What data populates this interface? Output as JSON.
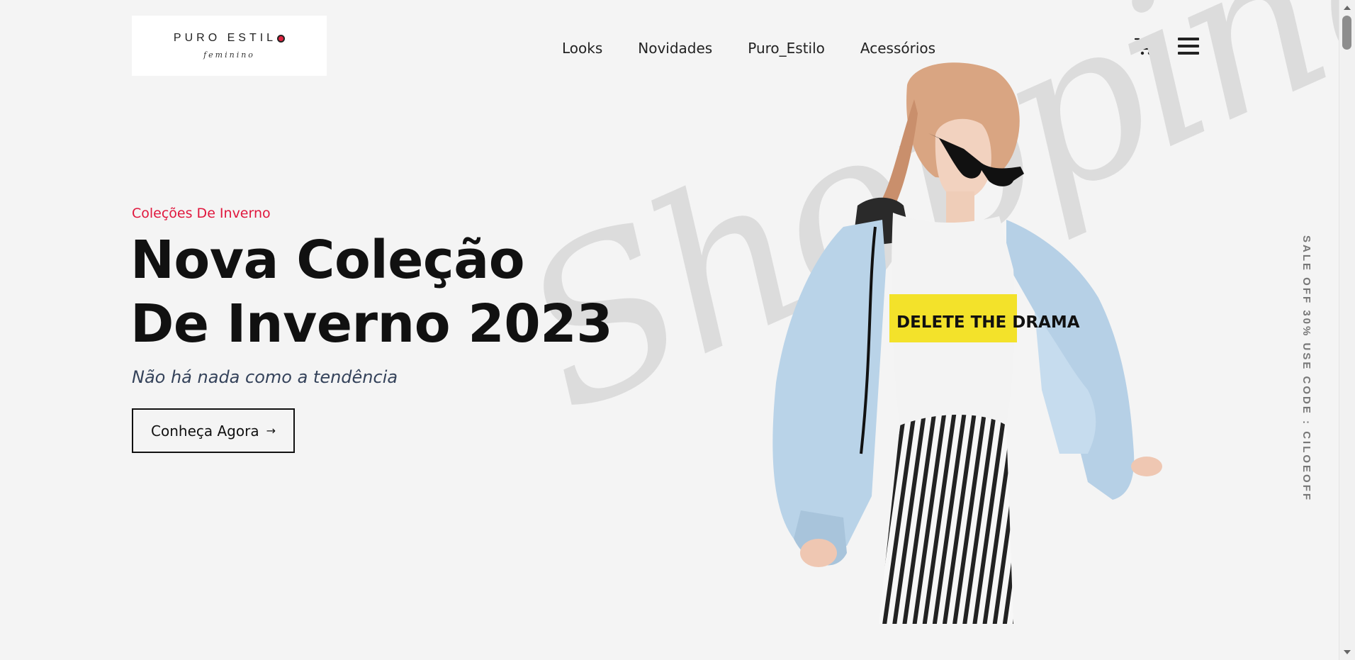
{
  "header": {
    "logo": {
      "name": "PURO ESTIL",
      "subtitle": "feminino"
    },
    "nav": [
      "Looks",
      "Novidades",
      "Puro_Estilo",
      "Acessórios"
    ],
    "icons": {
      "cart": "cart-icon",
      "menu": "hamburger-menu-icon"
    }
  },
  "hero": {
    "eyebrow": "Coleções De Inverno",
    "headline_line1": "Nova Coleção",
    "headline_line2": "De Inverno 2023",
    "tagline": "Não há nada como a tendência",
    "cta_label": "Conheça Agora",
    "cta_icon": "arrow-right-icon",
    "watermark": "Shopping",
    "shirt_text": "DELETE THE DRAMA"
  },
  "promo": "SALE OFF 30% USE CODE : CILOEOFF",
  "colors": {
    "accent": "#e0173d",
    "background": "#f4f4f4",
    "text": "#111111",
    "tagline": "#34425a"
  }
}
